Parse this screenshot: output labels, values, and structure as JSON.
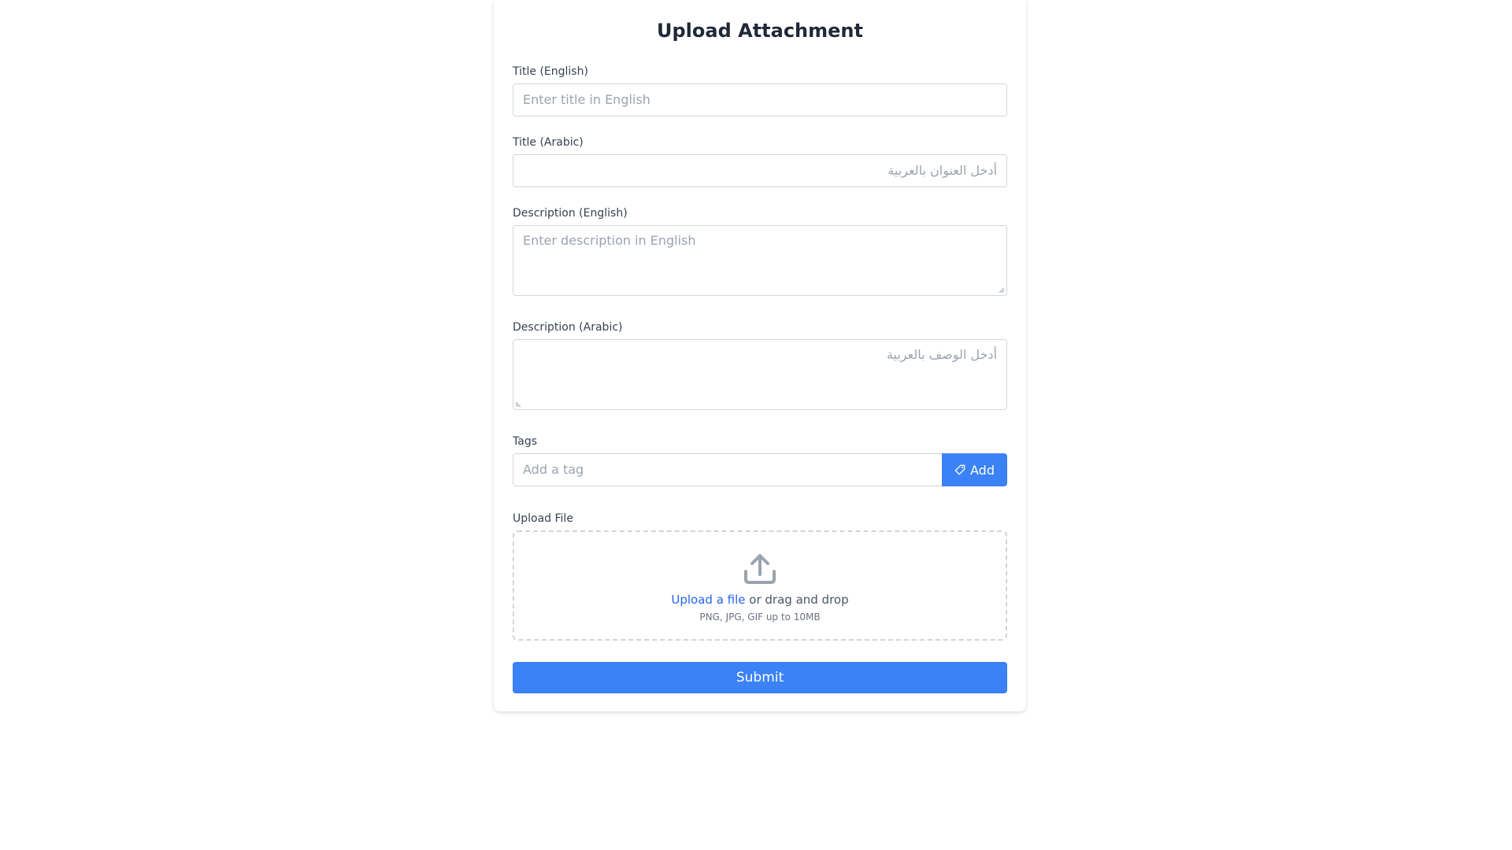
{
  "form": {
    "heading": "Upload Attachment",
    "title_en": {
      "label": "Title (English)",
      "placeholder": "Enter title in English"
    },
    "title_ar": {
      "label": "Title (Arabic)",
      "placeholder": "أدخل العنوان بالعربية"
    },
    "desc_en": {
      "label": "Description (English)",
      "placeholder": "Enter description in English"
    },
    "desc_ar": {
      "label": "Description (Arabic)",
      "placeholder": "أدخل الوصف بالعربية"
    },
    "tags": {
      "label": "Tags",
      "placeholder": "Add a tag",
      "add_label": "Add",
      "add_icon": "tag-icon"
    },
    "upload": {
      "label": "Upload File",
      "icon": "upload-icon",
      "link_text": "Upload a file",
      "drag_text": " or drag and drop",
      "hint": "PNG, JPG, GIF up to 10MB"
    },
    "submit_label": "Submit"
  },
  "colors": {
    "accent": "#3b82f6",
    "link": "#2563eb",
    "border": "#d1d5db",
    "placeholder": "#9ca3af"
  }
}
